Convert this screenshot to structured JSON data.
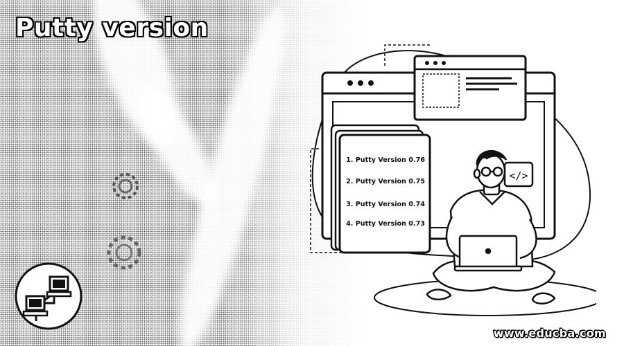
{
  "banner": {
    "title": "Putty version",
    "website": "www.educba.com"
  },
  "versions": {
    "items": [
      "1. Putty Version 0.76",
      "2. Putty Version 0.75",
      "3. Putty Version 0.74",
      "4. Putty Version 0.73"
    ]
  },
  "illustration": {
    "code_icon": "</>",
    "icons": [
      "network-computers-icon",
      "gear-icon",
      "browser-window-icon",
      "person-with-laptop-icon",
      "code-tag-icon"
    ]
  },
  "colors": {
    "ink": "#111111",
    "paper": "#ffffff"
  }
}
